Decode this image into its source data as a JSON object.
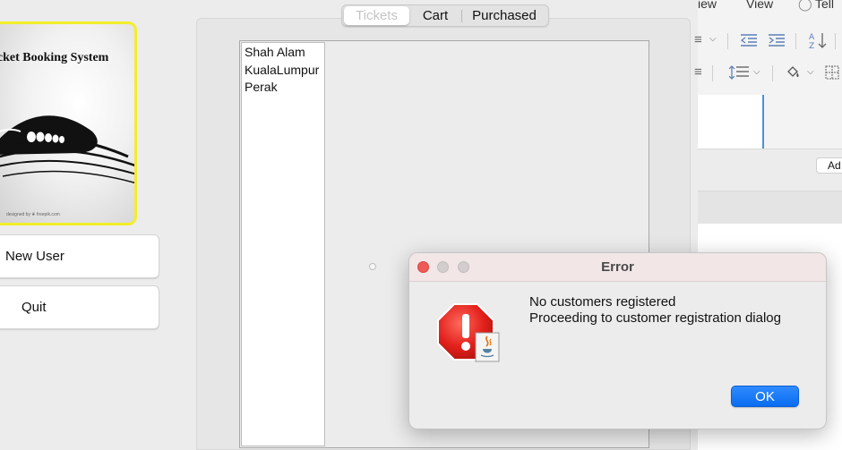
{
  "left_panel": {
    "logo_title": "icket Booking System",
    "logo_credit": "designed by ❦ freepik.com",
    "buttons": {
      "new_user": "New User",
      "quit": "Quit"
    }
  },
  "center_panel": {
    "tabs": [
      {
        "label": "Tickets",
        "selected": true
      },
      {
        "label": "Cart",
        "selected": false
      },
      {
        "label": "Purchased",
        "selected": false
      }
    ],
    "locations": [
      "Shah Alam",
      "KualaLumpur",
      "Perak"
    ]
  },
  "background_app": {
    "menu": [
      "iew",
      "View",
      "Tell"
    ],
    "add_button": "Ad"
  },
  "dialog": {
    "title": "Error",
    "message_line_1": "No customers registered",
    "message_line_2": "Proceeding to customer registration dialog",
    "ok_label": "OK"
  },
  "colors": {
    "logo_border": "#f2ee2a",
    "ok_button": "#0a6cf0",
    "close_dot": "#ee5b56",
    "error_octagon": "#e2211c"
  }
}
